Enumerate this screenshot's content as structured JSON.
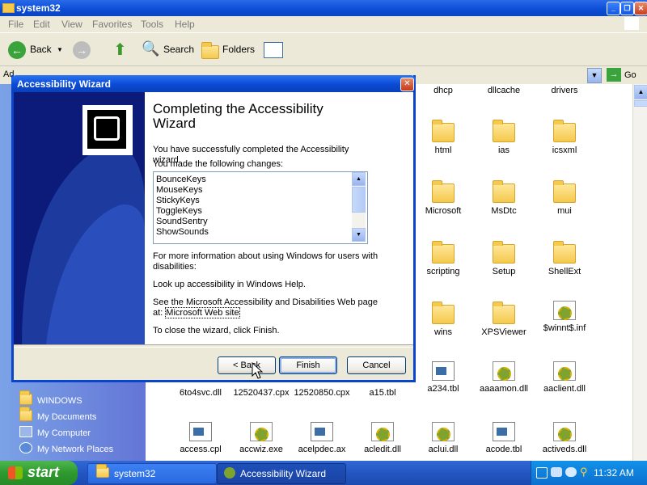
{
  "explorer": {
    "title": "system32",
    "menu": [
      "File",
      "Edit",
      "View",
      "Favorites",
      "Tools",
      "Help"
    ],
    "toolbar": {
      "back": "Back",
      "search": "Search",
      "folders": "Folders"
    },
    "address": {
      "label": "Ad",
      "go": "Go"
    },
    "tasks": [
      {
        "label": "WINDOWS",
        "icon": "folder-icon"
      },
      {
        "label": "My Documents",
        "icon": "folder-icon"
      },
      {
        "label": "My Computer",
        "icon": "computer-icon"
      },
      {
        "label": "My Network Places",
        "icon": "network-icon"
      }
    ],
    "files_top": [
      "dhcp",
      "dllcache",
      "drivers"
    ],
    "files": [
      {
        "name": "html",
        "type": "folder"
      },
      {
        "name": "ias",
        "type": "folder"
      },
      {
        "name": "icsxml",
        "type": "folder"
      },
      {
        "name": "Microsoft",
        "type": "folder"
      },
      {
        "name": "MsDtc",
        "type": "folder"
      },
      {
        "name": "mui",
        "type": "folder"
      },
      {
        "name": "scripting",
        "type": "folder"
      },
      {
        "name": "Setup",
        "type": "folder"
      },
      {
        "name": "ShellExt",
        "type": "folder"
      },
      {
        "name": "wins",
        "type": "folder"
      },
      {
        "name": "XPSViewer",
        "type": "folder"
      },
      {
        "name": "$winnt$.inf",
        "type": "gear"
      },
      {
        "name": "6to4svc.dll",
        "type": "none"
      },
      {
        "name": "12520437.cpx",
        "type": "none"
      },
      {
        "name": "12520850.cpx",
        "type": "none"
      },
      {
        "name": "a15.tbl",
        "type": "none"
      },
      {
        "name": "a234.tbl",
        "type": "doc"
      },
      {
        "name": "aaaamon.dll",
        "type": "gear"
      },
      {
        "name": "aaclient.dll",
        "type": "gear"
      },
      {
        "name": "access.cpl",
        "type": "doc"
      },
      {
        "name": "accwiz.exe",
        "type": "gear"
      },
      {
        "name": "acelpdec.ax",
        "type": "doc"
      },
      {
        "name": "acledit.dll",
        "type": "gear"
      },
      {
        "name": "aclui.dll",
        "type": "gear"
      },
      {
        "name": "acode.tbl",
        "type": "doc"
      },
      {
        "name": "activeds.dll",
        "type": "gear"
      }
    ]
  },
  "wizard": {
    "title": "Accessibility Wizard",
    "heading_line1": "Completing the Accessibility",
    "heading_line2": "Wizard",
    "success": "You have successfully completed the Accessibility wizard.",
    "changes_label": "You made the following changes:",
    "changes": [
      "BounceKeys",
      "MouseKeys",
      "StickyKeys",
      "ToggleKeys",
      "SoundSentry",
      "ShowSounds"
    ],
    "more_info_1": "For more information about using Windows for users with",
    "more_info_2": "disabilities:",
    "lookup": "Look up accessibility in Windows Help.",
    "see_1": "See the Microsoft Accessibility and Disabilities Web page",
    "see_2": "at:",
    "link": "Microsoft Web site",
    "close_text": "To close the wizard, click Finish.",
    "back_button": "< Back",
    "finish_button": "Finish",
    "cancel_button": "Cancel"
  },
  "taskbar": {
    "start": "start",
    "items": [
      "system32",
      "Accessibility Wizard"
    ],
    "clock": "11:32 AM"
  }
}
